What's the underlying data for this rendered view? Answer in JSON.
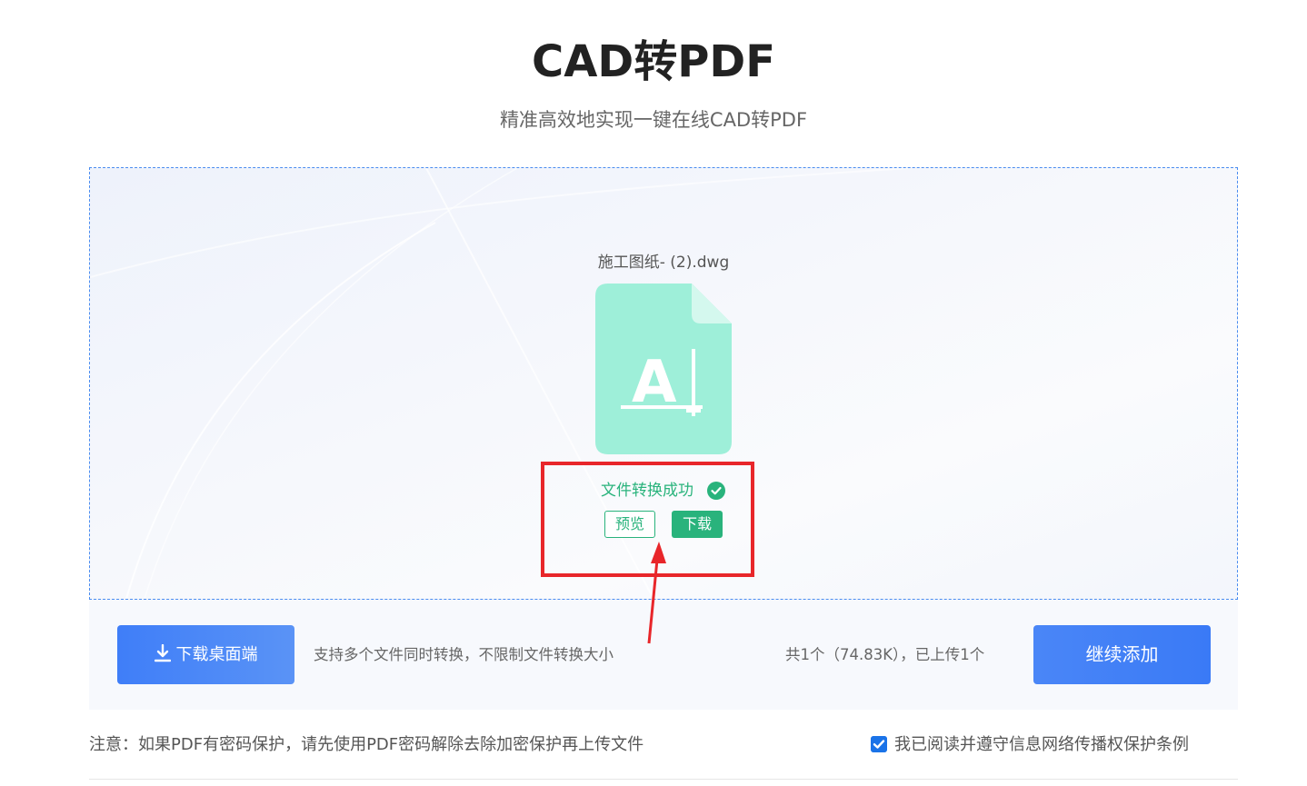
{
  "header": {
    "title": "CAD转PDF",
    "subtitle": "精准高效地实现一键在线CAD转PDF"
  },
  "upload": {
    "file_name": "施工图纸- (2).dwg",
    "file_icon": "cad-file-icon",
    "file_icon_letter": "A",
    "status_text": "文件转换成功",
    "status_icon": "check-circle-icon",
    "preview_label": "预览",
    "download_label": "下载"
  },
  "toolbar": {
    "desktop_label": "下载桌面端",
    "desktop_icon": "download-icon",
    "support_text": "支持多个文件同时转换，不限制文件转换大小",
    "count_text": "共1个（74.83K），已上传1个",
    "continue_label": "继续添加"
  },
  "footer": {
    "note_text": "注意：如果PDF有密码保护，请先使用PDF密码解除去除加密保护再上传文件",
    "agree_text": "我已阅读并遵守信息网络传播权保护条例",
    "agree_checked": true
  },
  "colors": {
    "accent_blue": "#3f7ef8",
    "success_green": "#29b37c",
    "file_icon_fill": "#9eefd9",
    "highlight_red": "#e8262a"
  }
}
